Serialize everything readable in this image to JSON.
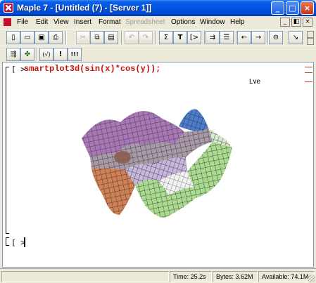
{
  "window": {
    "title": "Maple 7 - [Untitled (7) - [Server 1]]",
    "minimize_glyph": "_",
    "maximize_glyph": "□",
    "close_glyph": "×"
  },
  "menubar": {
    "items": [
      {
        "label": "File",
        "enabled": true
      },
      {
        "label": "Edit",
        "enabled": true
      },
      {
        "label": "View",
        "enabled": true
      },
      {
        "label": "Insert",
        "enabled": true
      },
      {
        "label": "Format",
        "enabled": true
      },
      {
        "label": "Spreadsheet",
        "enabled": false
      },
      {
        "label": "Options",
        "enabled": true
      },
      {
        "label": "Window",
        "enabled": true
      },
      {
        "label": "Help",
        "enabled": true
      }
    ],
    "doc_min_glyph": "_",
    "doc_restore_glyph": "◧",
    "doc_close_glyph": "×"
  },
  "toolbar1": {
    "buttons": [
      {
        "icon": "new-file-icon",
        "glyph": "▯"
      },
      {
        "icon": "open-folder-icon",
        "glyph": "▭"
      },
      {
        "icon": "save-icon",
        "glyph": "▣"
      },
      {
        "icon": "print-icon",
        "glyph": "⎙"
      },
      {
        "icon": "cut-icon",
        "glyph": "✂"
      },
      {
        "icon": "copy-icon",
        "glyph": "⧉"
      },
      {
        "icon": "paste-icon",
        "glyph": "▤"
      },
      {
        "icon": "undo-icon",
        "glyph": "↶"
      },
      {
        "icon": "redo-icon",
        "glyph": "↷"
      },
      {
        "icon": "sum-icon",
        "glyph": "Σ"
      },
      {
        "icon": "text-icon",
        "glyph": "T"
      },
      {
        "icon": "math-input-icon",
        "glyph": "[>"
      },
      {
        "icon": "insert-region-icon",
        "glyph": "⇉"
      },
      {
        "icon": "insert-section-icon",
        "glyph": "☰"
      },
      {
        "icon": "outdent-icon",
        "glyph": "←"
      },
      {
        "icon": "indent-icon",
        "glyph": "→"
      },
      {
        "icon": "stop-icon",
        "glyph": "⊖"
      },
      {
        "icon": "restart-icon",
        "glyph": "↘"
      }
    ]
  },
  "toolbar2": {
    "buttons": [
      {
        "icon": "execute-worksheet-icon",
        "glyph": "⇶"
      },
      {
        "icon": "maple-leaf-icon",
        "glyph": "✤"
      },
      {
        "icon": "check-syntax-icon",
        "glyph": "(√)"
      },
      {
        "icon": "exclamation-icon",
        "glyph": "!"
      },
      {
        "icon": "execute-all-icon",
        "glyph": "!!!"
      }
    ]
  },
  "worksheet": {
    "prompt": "[ >",
    "command": "smartplot3d(sin(x)*cos(y));",
    "label": "Lve",
    "prompt2": "[ >"
  },
  "status": {
    "time": "Time: 25.2s",
    "bytes": "Bytes: 3.62M",
    "available": "Available: 74.1M"
  },
  "colors": {
    "command": "#c3140e",
    "plot_purple": "#b07ac0",
    "plot_blue": "#4a7ec8",
    "plot_green": "#a8d890",
    "plot_orange": "#d08050"
  }
}
